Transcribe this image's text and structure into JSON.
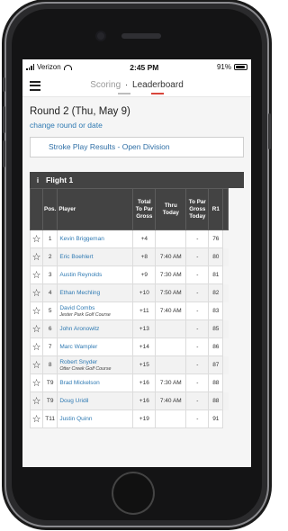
{
  "status": {
    "carrier": "Verizon",
    "time": "2:45 PM",
    "battery": "91%",
    "battery_level": 0.91
  },
  "nav": {
    "scoring": "Scoring",
    "separator": "·",
    "leaderboard": "Leaderboard"
  },
  "round": {
    "title": "Round 2 (Thu, May 9)",
    "change_link": "change round or date"
  },
  "division": {
    "label": "Stroke Play Results - Open Division"
  },
  "flight": {
    "info_icon": "i",
    "title": "Flight 1"
  },
  "table": {
    "headers": {
      "pos": "Pos.",
      "player": "Player",
      "total": "Total To Par Gross",
      "thru": "Thru Today",
      "today": "To Par Gross Today",
      "r1": "R1"
    },
    "rows": [
      {
        "pos": "1",
        "player": "Kevin Briggeman",
        "course": "",
        "total": "+4",
        "thru": "",
        "today": "-",
        "r1": "76"
      },
      {
        "pos": "2",
        "player": "Eric Boehlert",
        "course": "",
        "total": "+8",
        "thru": "7:40 AM",
        "today": "-",
        "r1": "80"
      },
      {
        "pos": "3",
        "player": "Austin Reynolds",
        "course": "",
        "total": "+9",
        "thru": "7:30 AM",
        "today": "-",
        "r1": "81"
      },
      {
        "pos": "4",
        "player": "Ethan Mechling",
        "course": "",
        "total": "+10",
        "thru": "7:50 AM",
        "today": "-",
        "r1": "82"
      },
      {
        "pos": "5",
        "player": "David Combs",
        "course": "Jester Park Golf Course",
        "total": "+11",
        "thru": "7:40 AM",
        "today": "-",
        "r1": "83"
      },
      {
        "pos": "6",
        "player": "John Aronowitz",
        "course": "",
        "total": "+13",
        "thru": "",
        "today": "-",
        "r1": "85"
      },
      {
        "pos": "7",
        "player": "Marc Wampler",
        "course": "",
        "total": "+14",
        "thru": "",
        "today": "-",
        "r1": "86"
      },
      {
        "pos": "8",
        "player": "Robert Snyder",
        "course": "Otter Creek Golf Course",
        "total": "+15",
        "thru": "",
        "today": "-",
        "r1": "87"
      },
      {
        "pos": "T9",
        "player": "Brad Mickelson",
        "course": "",
        "total": "+16",
        "thru": "7:30 AM",
        "today": "-",
        "r1": "88"
      },
      {
        "pos": "T9",
        "player": "Doug Uridil",
        "course": "",
        "total": "+16",
        "thru": "7:40 AM",
        "today": "-",
        "r1": "88"
      },
      {
        "pos": "T11",
        "player": "Justin Quinn",
        "course": "",
        "total": "+19",
        "thru": "",
        "today": "-",
        "r1": "91"
      }
    ]
  },
  "colors": {
    "accent": "#d9453b",
    "link": "#2f7ab3",
    "header_bg": "#434343"
  }
}
